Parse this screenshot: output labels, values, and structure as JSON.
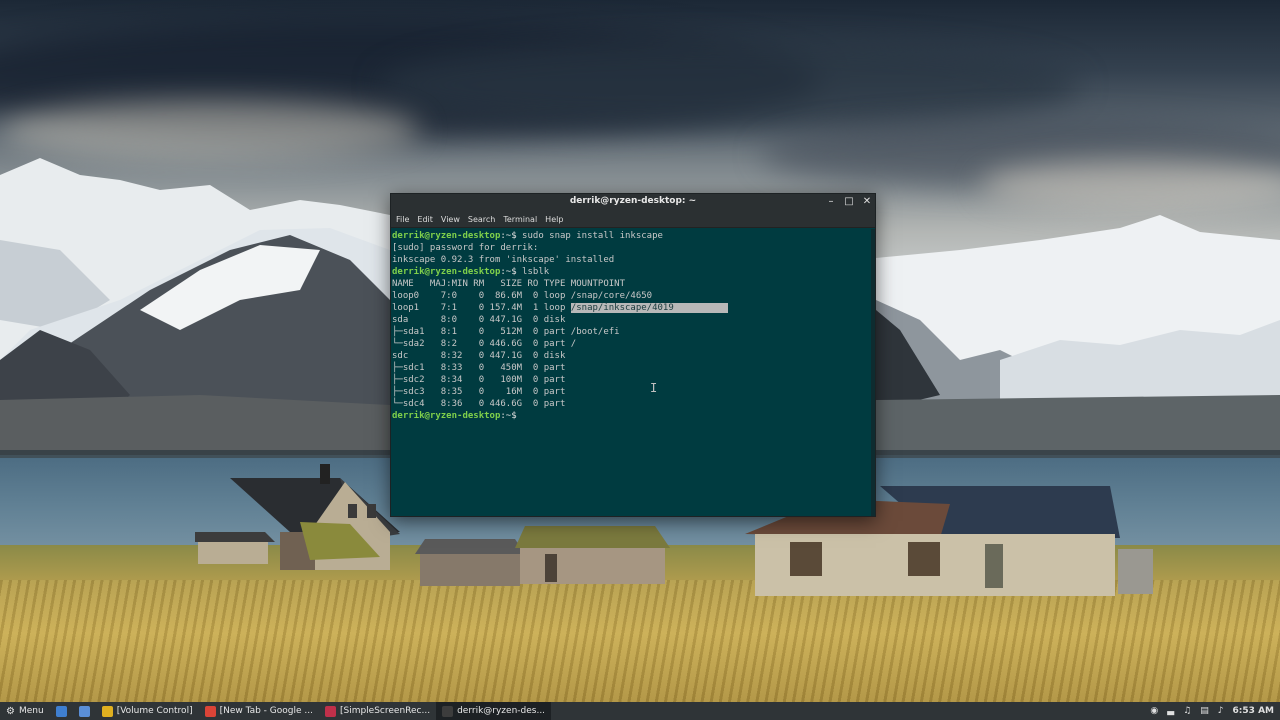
{
  "terminal": {
    "title": "derrik@ryzen-desktop: ~",
    "menu": [
      "File",
      "Edit",
      "View",
      "Search",
      "Terminal",
      "Help"
    ],
    "prompt_user": "derrik@ryzen-desktop",
    "prompt_path": ":~$",
    "lines": [
      {
        "type": "prompt",
        "cmd": " sudo snap install inkscape"
      },
      {
        "type": "out",
        "text": "[sudo] password for derrik:"
      },
      {
        "type": "out",
        "text": "inkscape 0.92.3 from 'inkscape' installed"
      },
      {
        "type": "prompt",
        "cmd": " lsblk"
      },
      {
        "type": "out",
        "text": "NAME   MAJ:MIN RM   SIZE RO TYPE MOUNTPOINT"
      },
      {
        "type": "out",
        "text": "loop0    7:0    0  86.6M  0 loop /snap/core/4650"
      },
      {
        "type": "out_hl",
        "text": "loop1    7:1    0 157.4M  1 loop ",
        "hl": "/snap/inkscape/4019          "
      },
      {
        "type": "out",
        "text": "sda      8:0    0 447.1G  0 disk"
      },
      {
        "type": "out",
        "text": "├─sda1   8:1    0   512M  0 part /boot/efi"
      },
      {
        "type": "out",
        "text": "└─sda2   8:2    0 446.6G  0 part /"
      },
      {
        "type": "out",
        "text": "sdc      8:32   0 447.1G  0 disk"
      },
      {
        "type": "out",
        "text": "├─sdc1   8:33   0   450M  0 part"
      },
      {
        "type": "out",
        "text": "├─sdc2   8:34   0   100M  0 part"
      },
      {
        "type": "out",
        "text": "├─sdc3   8:35   0    16M  0 part"
      },
      {
        "type": "out",
        "text": "└─sdc4   8:36   0 446.6G  0 part"
      },
      {
        "type": "prompt",
        "cmd": ""
      }
    ]
  },
  "taskbar": {
    "menu_label": "Menu",
    "items": [
      {
        "label": "[Volume Control]",
        "icon": "volume-control-icon",
        "color": "#e0b020"
      },
      {
        "label": "[New Tab - Google ...",
        "icon": "chrome-icon",
        "color": "#db4437"
      },
      {
        "label": "[SimpleScreenRec...",
        "icon": "screen-recorder-icon",
        "color": "#c0304a"
      },
      {
        "label": "derrik@ryzen-des...",
        "icon": "terminal-icon",
        "color": "#3c3c3c"
      }
    ],
    "clock": "6:53 AM"
  },
  "colors": {
    "terminal_bg": "#003b40",
    "prompt_green": "#7fd04a",
    "taskbar_bg": "#2f3437"
  }
}
